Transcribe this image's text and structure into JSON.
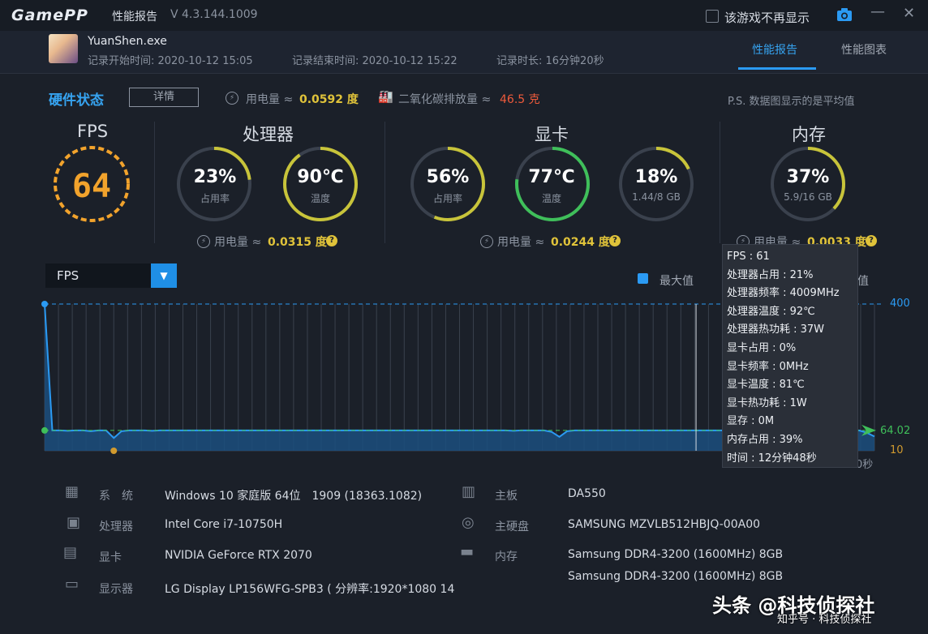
{
  "app": {
    "logo": "GamePP",
    "title": "性能报告",
    "version": "V 4.3.144.1009",
    "hide_label": "该游戏不再显示"
  },
  "header": {
    "process": "YuanShen.exe",
    "start": "记录开始时间: 2020-10-12 15:05",
    "end": "记录结束时间: 2020-10-12 15:22",
    "duration": "记录时长: 16分钟20秒",
    "tabs": [
      "性能报告",
      "性能图表"
    ]
  },
  "status": {
    "title": "硬件状态",
    "detail_btn": "详情",
    "power_label": "用电量 ≈",
    "power_value": "0.0592 度",
    "co2_label": "二氧化碳排放量 ≈",
    "co2_value": "46.5 克",
    "ps": "P.S. 数据图显示的是平均值"
  },
  "fps": {
    "title": "FPS",
    "value": "64"
  },
  "cpu": {
    "title": "处理器",
    "usage": "23%",
    "usage_label": "占用率",
    "temp": "90℃",
    "temp_label": "温度",
    "power_label": "用电量 ≈",
    "power_value": "0.0315 度"
  },
  "gpu": {
    "title": "显卡",
    "usage": "56%",
    "usage_label": "占用率",
    "temp": "77℃",
    "temp_label": "温度",
    "vram": "18%",
    "vram_label": "1.44/8 GB",
    "power_label": "用电量 ≈",
    "power_value": "0.0244 度"
  },
  "mem": {
    "title": "内存",
    "usage": "37%",
    "usage_label": "5.9/16 GB",
    "power_label": "用电量 ≈",
    "power_value": "0.0033 度"
  },
  "ring_fractions": {
    "cpu_usage": 0.23,
    "cpu_temp": 0.9,
    "gpu_usage": 0.56,
    "gpu_temp": 0.77,
    "gpu_vram": 0.18,
    "mem_usage": 0.37
  },
  "colors": {
    "accent": "#2b9af3",
    "ring_yellow": "#c8c43a",
    "ring_green": "#3fbf5a",
    "fps_ring": "#f2a32c",
    "value_yellow": "#e0c33a",
    "value_red": "#ee5a3b"
  },
  "chart": {
    "selector": "FPS",
    "legend_max": "最大值",
    "legend_avg_fragment": "值",
    "y_max_label": "400",
    "y_avg_label": "64.02",
    "y_min_label": "10",
    "x_end_fragment": "0秒"
  },
  "chart_data": {
    "type": "area",
    "ylim": [
      10,
      400
    ],
    "series": [
      {
        "name": "FPS",
        "values": [
          400,
          64,
          64,
          63,
          64,
          64,
          62,
          64,
          64,
          44,
          62,
          64,
          64,
          64,
          63,
          64,
          64,
          64,
          64,
          64,
          64,
          64,
          64,
          64,
          64,
          64,
          64,
          64,
          64,
          64,
          64,
          64,
          64,
          64,
          64,
          64,
          64,
          64,
          64,
          64,
          64,
          64,
          64,
          64,
          64,
          64,
          64,
          64,
          64,
          64,
          64,
          64,
          64,
          64,
          64,
          64,
          64,
          64,
          64,
          64,
          64,
          63,
          64,
          64,
          64,
          64,
          60,
          47,
          62,
          64,
          64,
          64,
          64,
          64,
          64,
          64,
          64,
          64,
          64,
          64,
          64,
          64,
          64,
          64,
          64,
          64,
          64,
          64,
          64,
          64,
          64,
          64,
          64,
          64,
          64,
          64,
          64,
          64,
          64,
          64,
          64,
          64,
          64,
          64,
          64,
          64,
          64,
          58,
          48
        ]
      }
    ],
    "max": 400,
    "avg": 64.02,
    "min": 10
  },
  "tooltip": [
    "FPS : 61",
    "处理器占用 : 21%",
    "处理器频率 : 4009MHz",
    "处理器温度 : 92℃",
    "处理器热功耗 : 37W",
    "显卡占用 : 0%",
    "显卡频率 : 0MHz",
    "显卡温度 : 81℃",
    "显卡热功耗 : 1W",
    "显存 : 0M",
    "内存占用 : 39%",
    "时间 : 12分钟48秒"
  ],
  "sysinfo": {
    "os_label": "系　统",
    "os": "Windows 10 家庭版 64位　1909 (18363.1082)",
    "cpu_label": "处理器",
    "cpu": "Intel Core i7-10750H",
    "gpu_label": "显卡",
    "gpu": "NVIDIA GeForce RTX 2070",
    "monitor_label": "显示器",
    "monitor": "LG Display LP156WFG-SPB3 ( 分辨率:1920*1080 14",
    "board_label": "主板",
    "board": "DA550",
    "disk_label": "主硬盘",
    "disk": "SAMSUNG MZVLB512HBJQ-00A00",
    "mem_label": "内存",
    "mem1": "Samsung DDR4-3200 (1600MHz) 8GB",
    "mem2": "Samsung DDR4-3200 (1600MHz) 8GB"
  },
  "watermark": {
    "big": "头条 @科技侦探社",
    "small": "知乎号 · 科技侦探社"
  }
}
